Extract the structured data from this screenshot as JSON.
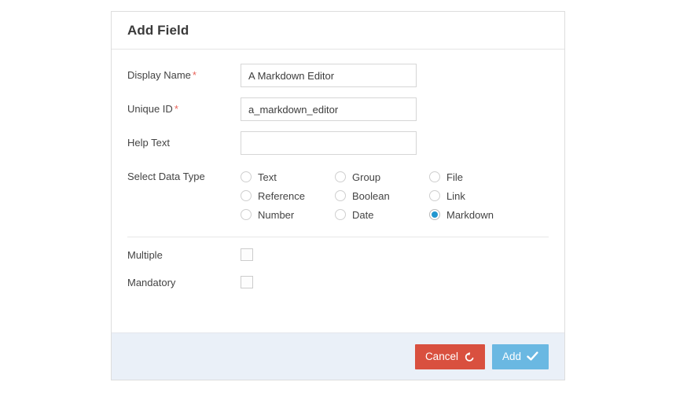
{
  "dialog": {
    "title": "Add Field",
    "fields": [
      {
        "label": "Display Name",
        "required": true,
        "required_marker": "*",
        "value": "A Markdown Editor",
        "placeholder": ""
      },
      {
        "label": "Unique ID",
        "required": true,
        "required_marker": "*",
        "value": "a_markdown_editor",
        "placeholder": ""
      },
      {
        "label": "Help Text",
        "required": false,
        "required_marker": "",
        "value": "",
        "placeholder": ""
      }
    ],
    "data_type": {
      "label": "Select Data Type",
      "selected": "Markdown",
      "options": [
        "Text",
        "Group",
        "File",
        "Reference",
        "Boolean",
        "Link",
        "Number",
        "Date",
        "Markdown"
      ]
    },
    "toggles": [
      {
        "label": "Multiple",
        "checked": false
      },
      {
        "label": "Mandatory",
        "checked": false
      }
    ],
    "footer": {
      "cancel_label": "Cancel",
      "cancel_icon": "undo-icon",
      "add_label": "Add",
      "add_icon": "check-icon"
    }
  },
  "colors": {
    "cancel_button": "#d9503f",
    "add_button": "#6ab8e2",
    "radio_selected": "#2196cf",
    "required_asterisk": "#e8635a",
    "footer_background": "#eaf0f8",
    "card_border": "#dddddd"
  }
}
